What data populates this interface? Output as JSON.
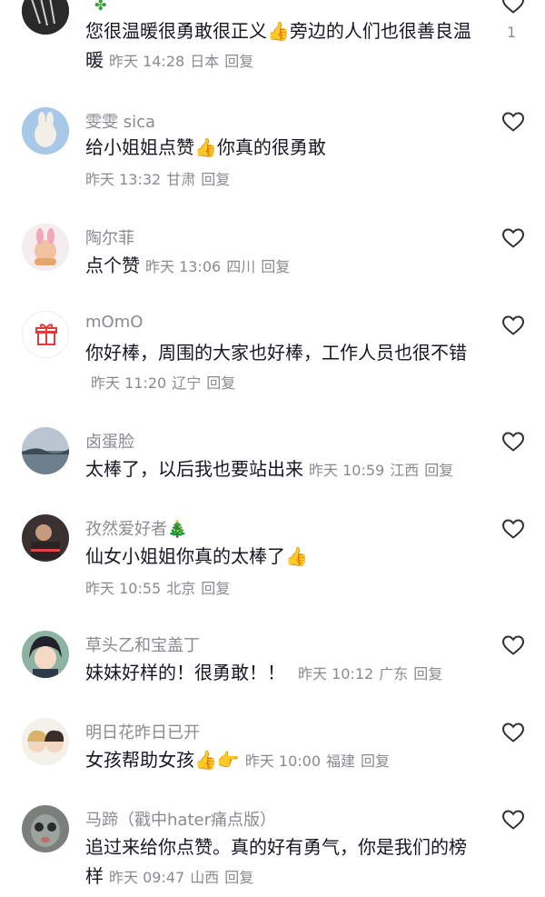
{
  "comments": [
    {
      "username": "",
      "text": "您很温暖很勇敢很正义👍旁边的人们也很善良温暖",
      "time": "昨天 14:28",
      "location": "日本",
      "reply": "回复",
      "likes": "1"
    },
    {
      "username": "雯雯 sica",
      "text": "给小姐姐点赞👍你真的很勇敢",
      "time": "昨天 13:32",
      "location": "甘肃",
      "reply": "回复"
    },
    {
      "username": "陶尔菲",
      "text": "点个赞",
      "time": "昨天 13:06",
      "location": "四川",
      "reply": "回复"
    },
    {
      "username": "mOmO",
      "text": "你好棒，周围的大家也好棒，工作人员也很不错",
      "time": "昨天 11:20",
      "location": "辽宁",
      "reply": "回复"
    },
    {
      "username": "卤蛋脸",
      "text": "太棒了，以后我也要站出来",
      "time": "昨天 10:59",
      "location": "江西",
      "reply": "回复"
    },
    {
      "username": "孜然爱好者🎄",
      "text": "仙女小姐姐你真的太棒了👍",
      "time": "昨天 10:55",
      "location": "北京",
      "reply": "回复"
    },
    {
      "username": "草头乙和宝盖丁",
      "text": "妹妹好样的！很勇敢！！",
      "time": "昨天 10:12",
      "location": "广东",
      "reply": "回复"
    },
    {
      "username": "明日花昨日已开",
      "text": "女孩帮助女孩👍👉",
      "time": "昨天 10:00",
      "location": "福建",
      "reply": "回复"
    },
    {
      "username": "马蹄（戳中hater痛点版）",
      "text": "追过来给你点赞。真的好有勇气，你是我们的榜样",
      "time": "昨天 09:47",
      "location": "山西",
      "reply": "回复"
    }
  ],
  "icons": {
    "like": "heart-outline-icon",
    "gift": "gift-icon"
  },
  "colors": {
    "meta": "#8a8b91",
    "text": "#161823"
  }
}
